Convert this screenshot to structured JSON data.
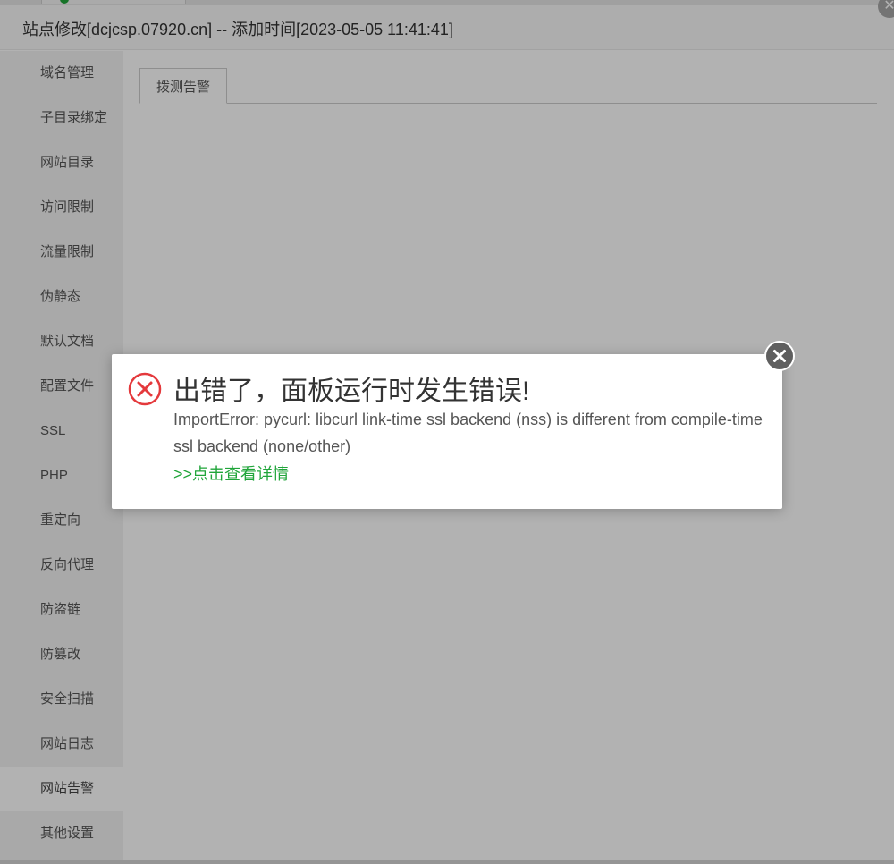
{
  "window": {
    "title": "站点修改[dcjcsp.07920.cn] -- 添加时间[2023-05-05 11:41:41]",
    "close_glyph": "✕"
  },
  "sidebar": {
    "items": [
      {
        "label": "域名管理"
      },
      {
        "label": "子目录绑定"
      },
      {
        "label": "网站目录"
      },
      {
        "label": "访问限制"
      },
      {
        "label": "流量限制"
      },
      {
        "label": "伪静态"
      },
      {
        "label": "默认文档"
      },
      {
        "label": "配置文件"
      },
      {
        "label": "SSL"
      },
      {
        "label": "PHP"
      },
      {
        "label": "重定向"
      },
      {
        "label": "反向代理"
      },
      {
        "label": "防盗链"
      },
      {
        "label": "防篡改"
      },
      {
        "label": "安全扫描"
      },
      {
        "label": "网站日志"
      },
      {
        "label": "网站告警",
        "active": true
      },
      {
        "label": "其他设置"
      }
    ]
  },
  "main": {
    "tabs": [
      {
        "label": "拨测告警"
      }
    ]
  },
  "error_dialog": {
    "title": "出错了，面板运行时发生错误!",
    "message": "ImportError: pycurl: libcurl link-time ssl backend (nss) is different from compile-time ssl backend (none/other)",
    "details_link": ">>点击查看详情",
    "icon": "error-circle-x-icon",
    "close_icon": "close-circle-icon"
  },
  "colors": {
    "accent_green": "#20a53a",
    "error_red": "#e4393c",
    "close_button": "#5f5f5f"
  }
}
